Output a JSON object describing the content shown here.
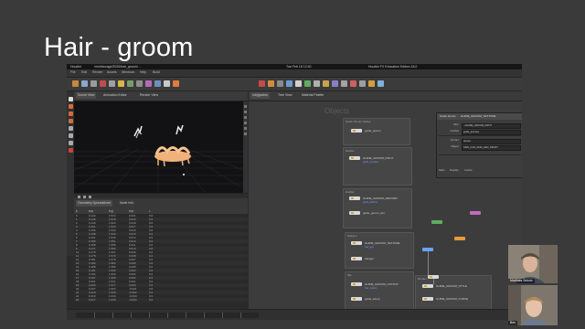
{
  "slide": {
    "title": "Hair - groom"
  },
  "mac_bar": {
    "app": "Houdini",
    "path": "/mnt/storage/2020/hair_groom/...",
    "session": "Houdini FX Education Edition 18.0",
    "clock": "Tue Feb 18 12:40"
  },
  "menubar": {
    "items": [
      "File",
      "Edit",
      "Render",
      "Assets",
      "Windows",
      "Help",
      "Build"
    ]
  },
  "viewport": {
    "tabs": [
      "Scene View",
      "Animation Editor",
      "Render View"
    ],
    "camera_label": "No cam"
  },
  "spreadsheet": {
    "tabs": [
      "Geometry Spreadsheet",
      "Node Info"
    ],
    "columns": [
      "#",
      "P[x]",
      "P[y]",
      "P[z]",
      "v"
    ],
    "rows": [
      [
        "0",
        "0.142",
        "1.513",
        "0.021",
        "0.0"
      ],
      [
        "1",
        "0.145",
        "1.518",
        "0.020",
        "0.0"
      ],
      [
        "2",
        "0.149",
        "1.523",
        "0.018",
        "0.0"
      ],
      [
        "3",
        "0.151",
        "1.529",
        "0.017",
        "0.0"
      ],
      [
        "4",
        "0.156",
        "1.534",
        "0.016",
        "0.0"
      ],
      [
        "5",
        "0.158",
        "1.540",
        "0.015",
        "0.0"
      ],
      [
        "6",
        "0.161",
        "1.545",
        "0.014",
        "0.0"
      ],
      [
        "7",
        "0.165",
        "1.551",
        "0.013",
        "0.0"
      ],
      [
        "8",
        "0.168",
        "1.556",
        "0.011",
        "0.0"
      ],
      [
        "9",
        "0.171",
        "1.562",
        "0.010",
        "0.0"
      ],
      [
        "10",
        "0.175",
        "1.567",
        "0.009",
        "0.0"
      ],
      [
        "11",
        "0.178",
        "1.573",
        "0.008",
        "0.0"
      ],
      [
        "12",
        "0.181",
        "1.578",
        "0.007",
        "0.0"
      ],
      [
        "13",
        "0.184",
        "1.584",
        "0.006",
        "0.0"
      ],
      [
        "14",
        "0.188",
        "1.589",
        "0.005",
        "0.0"
      ],
      [
        "15",
        "0.191",
        "1.595",
        "0.004",
        "0.0"
      ],
      [
        "16",
        "0.194",
        "1.600",
        "0.003",
        "0.0"
      ],
      [
        "17",
        "0.197",
        "1.606",
        "0.002",
        "0.0"
      ],
      [
        "18",
        "0.201",
        "1.611",
        "0.001",
        "0.0"
      ],
      [
        "19",
        "0.204",
        "1.617",
        "0.000",
        "0.0"
      ],
      [
        "20",
        "0.207",
        "1.622",
        "-0.001",
        "0.0"
      ],
      [
        "21",
        "0.210",
        "1.628",
        "-0.002",
        "0.0"
      ],
      [
        "22",
        "0.213",
        "1.633",
        "-0.003",
        "0.0"
      ],
      [
        "23",
        "0.217",
        "1.639",
        "-0.004",
        "0.0"
      ]
    ]
  },
  "network": {
    "tabs": [
      "/obj/guides",
      "Tree View",
      "Material Palette"
    ],
    "context_label": "Objects",
    "boxes": [
      {
        "title": "Guide Groom Nodes"
      },
      {
        "title": "Guides"
      },
      {
        "title": "Guides"
      },
      {
        "title": "Hairgen"
      },
      {
        "title": "Sim"
      },
      {
        "title": "Render"
      }
    ],
    "nodes": [
      {
        "label": "guide_groom",
        "sub": "guide_deform"
      },
      {
        "label": "GUIDE_GROOM_INPUT",
        "sub": "guide_process"
      },
      {
        "label": "GUIDE_GROOM_DEFORM",
        "sub": "guide_deform"
      },
      {
        "label": "guide_groom_sim",
        "sub": "sim_guides"
      },
      {
        "label": "GUIDE_GROOM_TEXTURE",
        "sub": "hair_gen"
      },
      {
        "label": "GUIDE_GROOM_OUTPUT",
        "sub": "hair_output"
      },
      {
        "label": "GUIDE_GROOM_STYLE",
        "sub": "style_groom"
      },
      {
        "label": "hairgen",
        "sub": ""
      },
      {
        "label": "guide_interp",
        "sub": ""
      },
      {
        "label": "GUIDE_GROOM_CURVE",
        "sub": "curve_out"
      }
    ]
  },
  "params": {
    "header": "Guide Groom",
    "node_name": "GUIDE_GROOM_TEXTURE",
    "rows": [
      {
        "label": "Skin",
        "value": "../GUIDE_GROOM_INPUT"
      },
      {
        "label": "Guides",
        "value": "guide_process"
      },
      {
        "label": "Groom",
        "value": "texture"
      },
      {
        "label": "Object",
        "value": "SKIN_FUR_SKIN_GEO_PROXY"
      }
    ],
    "footer_tabs": [
      "Main",
      "Display",
      "Cache"
    ]
  },
  "webcams": [
    {
      "name": "Matthias Schulz"
    },
    {
      "name": "Ben"
    }
  ]
}
